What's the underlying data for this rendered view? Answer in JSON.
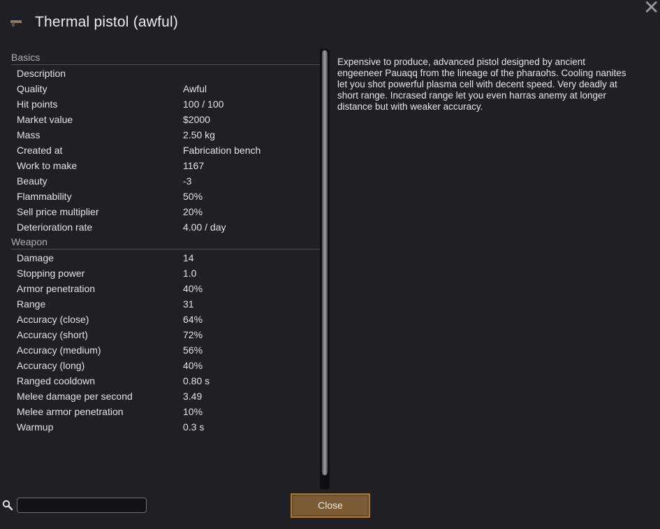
{
  "window": {
    "title": "Thermal pistol (awful)",
    "close_glyph": "✕",
    "title_icon": "pistol-icon"
  },
  "sections": [
    {
      "name": "Basics",
      "rows": [
        {
          "label": "Description",
          "value": ""
        },
        {
          "label": "Quality",
          "value": "Awful"
        },
        {
          "label": "Hit points",
          "value": "100 / 100"
        },
        {
          "label": "Market value",
          "value": "$2000"
        },
        {
          "label": "Mass",
          "value": "2.50 kg"
        },
        {
          "label": "Created at",
          "value": "Fabrication bench"
        },
        {
          "label": "Work to make",
          "value": "1167"
        },
        {
          "label": "Beauty",
          "value": "-3"
        },
        {
          "label": "Flammability",
          "value": "50%"
        },
        {
          "label": "Sell price multiplier",
          "value": "20%"
        },
        {
          "label": "Deterioration rate",
          "value": "4.00 / day"
        }
      ]
    },
    {
      "name": "Weapon",
      "rows": [
        {
          "label": "Damage",
          "value": "14"
        },
        {
          "label": "Stopping power",
          "value": "1.0"
        },
        {
          "label": "Armor penetration",
          "value": "40%"
        },
        {
          "label": "Range",
          "value": "31"
        },
        {
          "label": "Accuracy (close)",
          "value": "64%"
        },
        {
          "label": "Accuracy (short)",
          "value": "72%"
        },
        {
          "label": "Accuracy (medium)",
          "value": "56%"
        },
        {
          "label": "Accuracy (long)",
          "value": "40%"
        },
        {
          "label": "Ranged cooldown",
          "value": "0.80 s"
        },
        {
          "label": "Melee damage per second",
          "value": "3.49"
        },
        {
          "label": "Melee armor penetration",
          "value": "10%"
        },
        {
          "label": "Warmup",
          "value": "0.3 s"
        }
      ]
    }
  ],
  "description": "Expensive to produce, advanced pistol designed by ancient engeeneer Pauaqq from the lineage of the pharaohs. Cooling nanites let you shot powerful plasma cell with decent speed. Very deadly at short range. Incrased range let you even harras anemy at longer distance but with weaker accuracy.",
  "search": {
    "value": "",
    "placeholder": ""
  },
  "footer": {
    "close_label": "Close"
  },
  "colors": {
    "background": "#1e2026",
    "button": "#7d5b34",
    "divider": "#4b4e54"
  }
}
